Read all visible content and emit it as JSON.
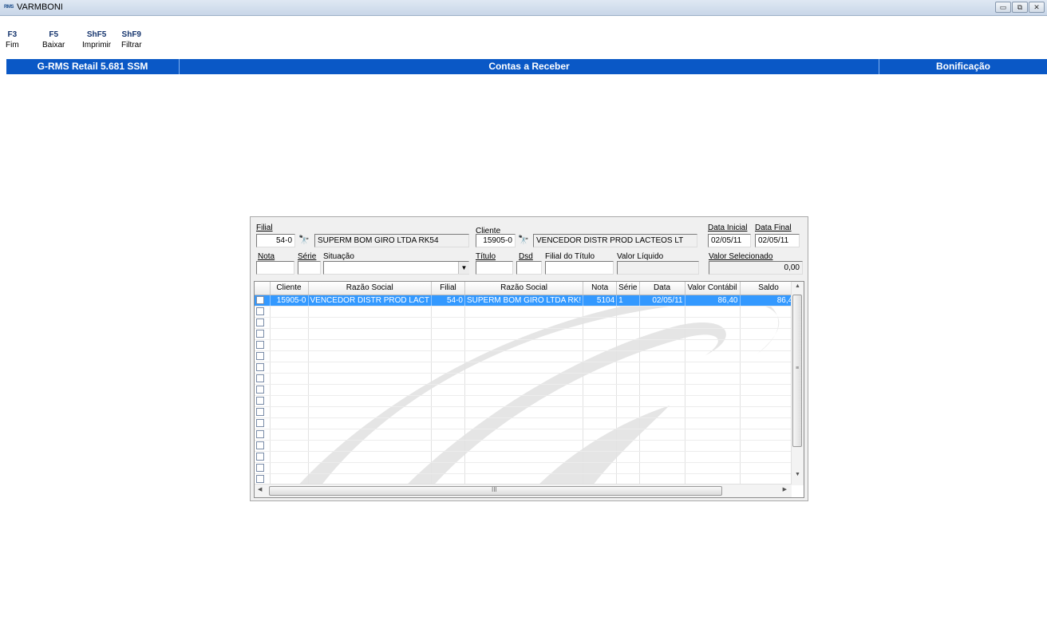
{
  "window": {
    "app_icon_text": "RMS",
    "title": "VARMBONI",
    "controls": {
      "minimize": "▭",
      "restore": "⧉",
      "close": "✕"
    }
  },
  "toolbar": {
    "keys": [
      {
        "key": "F3",
        "label": "Fim"
      },
      {
        "key": "F5",
        "label": "Baixar"
      },
      {
        "key": "ShF5",
        "label": "Imprimir"
      },
      {
        "key": "ShF9",
        "label": "Filtrar"
      }
    ]
  },
  "header": {
    "left": "G-RMS Retail 5.681 SSM",
    "center": "Contas a Receber",
    "right": "Bonificação"
  },
  "form": {
    "filial": {
      "label": "Filial",
      "code": "54-0",
      "name": "SUPERM BOM GIRO LTDA RK54"
    },
    "cliente": {
      "label": "Cliente",
      "code": "15905-0",
      "name": "VENCEDOR DISTR PROD LACTEOS LT"
    },
    "data_inicial": {
      "label": "Data Inicial",
      "value": "02/05/11"
    },
    "data_final": {
      "label": "Data Final",
      "value": "02/05/11"
    },
    "nota": {
      "label": "Nota",
      "value": ""
    },
    "serie": {
      "label": "Série",
      "value": ""
    },
    "situacao": {
      "label": "Situação",
      "value": ""
    },
    "titulo": {
      "label": "Título",
      "value": ""
    },
    "dsd": {
      "label": "Dsd",
      "value": ""
    },
    "filial_titulo": {
      "label": "Filial do Título",
      "value": ""
    },
    "valor_liquido": {
      "label": "Valor Líquido",
      "value": ""
    },
    "valor_selecionado": {
      "label": "Valor Selecionado",
      "value": "0,00"
    }
  },
  "grid": {
    "columns": [
      "",
      "Cliente",
      "Razão Social",
      "Filial",
      "Razão Social",
      "Nota",
      "Série",
      "Data",
      "Valor Contábil",
      "Saldo"
    ],
    "rows": [
      {
        "cliente": "15905-0",
        "razao_cliente": "VENCEDOR DISTR PROD LACT",
        "filial": "54-0",
        "razao_filial": "SUPERM BOM GIRO LTDA RK!",
        "nota": "5104",
        "serie": "1",
        "data": "02/05/11",
        "valor_contabil": "86,40",
        "saldo": "86,4("
      }
    ],
    "empty_rows": 16,
    "scroll": {
      "v_grip": "≡",
      "h_grip": "III"
    }
  },
  "colors": {
    "header_blue": "#0a58c6",
    "selection": "#3399ff",
    "key_color": "#16356e"
  }
}
